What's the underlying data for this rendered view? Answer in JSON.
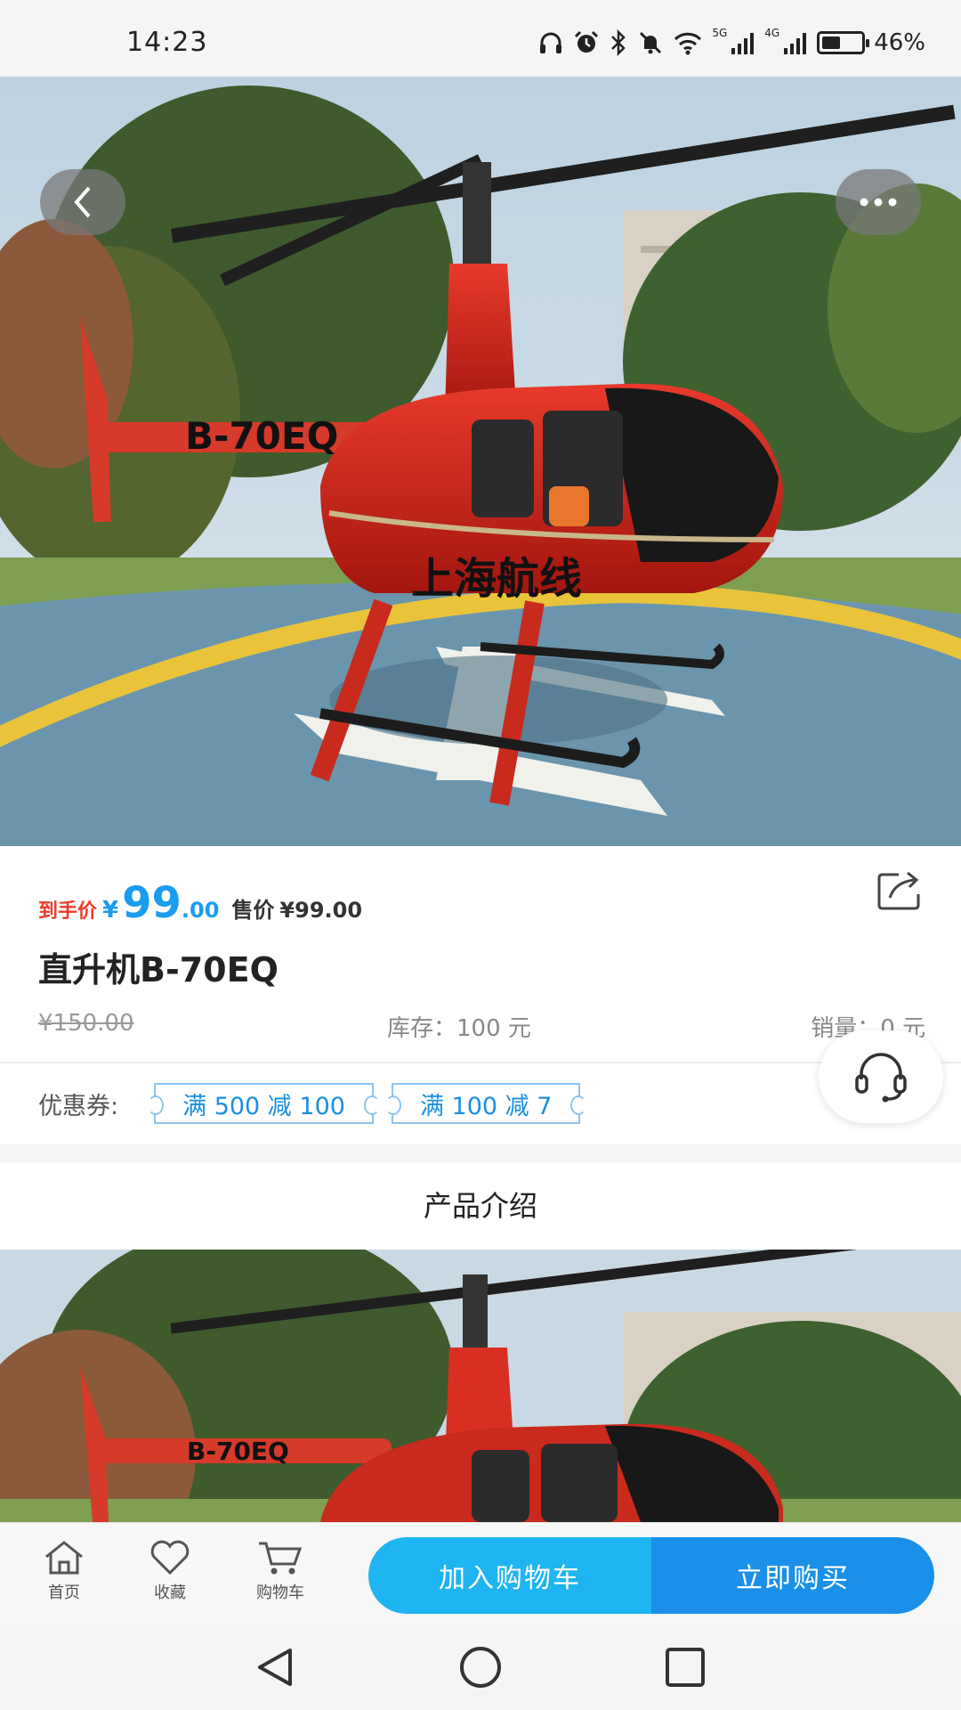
{
  "status_bar": {
    "time": "14:23",
    "net1": "5G",
    "net2": "4G",
    "battery_percent": "46%",
    "battery_level": 0.46
  },
  "hero": {
    "image": "helicopter-photo",
    "registration": "B-70EQ",
    "livery_text": "上海航线"
  },
  "price": {
    "final_label": "到手价",
    "currency": "¥",
    "final_integer": "99",
    "final_decimal": ".00",
    "sale_label": "售价",
    "sale_value": "¥99.00"
  },
  "product": {
    "title": "直升机B-70EQ",
    "original_price": "¥150.00",
    "stock": "库存：100 元",
    "sales": "销量：0 元"
  },
  "coupons": {
    "label": "优惠券:",
    "items": [
      "满 500 减 100",
      "满 100 减 7"
    ]
  },
  "intro": {
    "title": "产品介绍"
  },
  "bottom_bar": {
    "home": "首页",
    "favorite": "收藏",
    "cart": "购物车",
    "add_to_cart": "加入购物车",
    "buy_now": "立即购买"
  },
  "colors": {
    "accent_blue": "#1a9cf0",
    "price_red": "#ee3b2b",
    "cart_button": "#1fb4f2",
    "buy_button": "#1a90e8"
  }
}
